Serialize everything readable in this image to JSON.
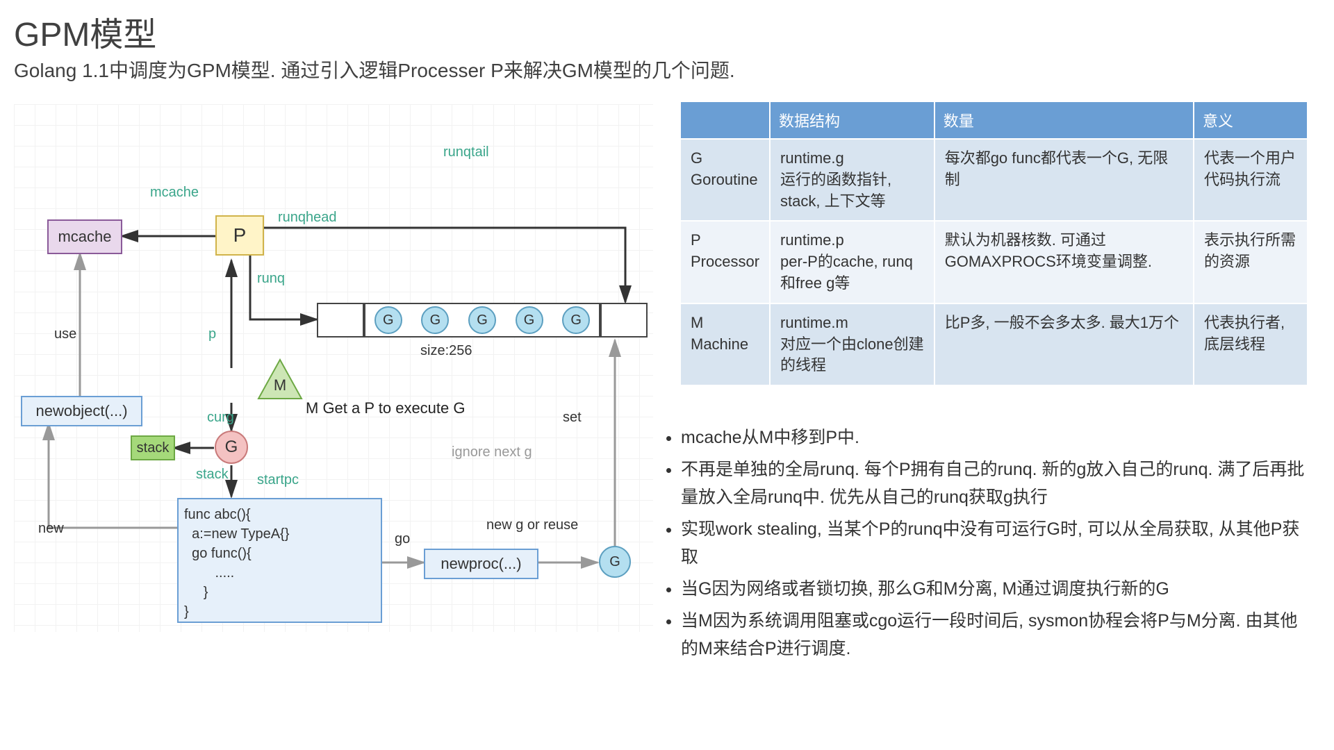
{
  "title": "GPM模型",
  "subtitle": "Golang 1.1中调度为GPM模型. 通过引入逻辑Processer P来解决GM模型的几个问题.",
  "diagram": {
    "mcache": "mcache",
    "newobject": "newobject(...)",
    "p": "P",
    "m": "M",
    "g": "G",
    "stack": "stack",
    "newproc": "newproc(...)",
    "g_end": "G",
    "runq_cells": [
      "G",
      "G",
      "G",
      "G",
      "G"
    ],
    "func_code": "func abc(){\n  a:=new TypeA{}\n  go func(){\n        .....\n     }\n}",
    "labels": {
      "mcache_lbl": "mcache",
      "runqhead": "runqhead",
      "runqtail": "runqtail",
      "runq": "runq",
      "p_lbl": "p",
      "curg": "curg",
      "stack_lbl": "stack",
      "startpc": "startpc",
      "use": "use",
      "new": "new",
      "go": "go",
      "set": "set",
      "ignore": "ignore next g",
      "new_g": "new g or reuse",
      "size": "size:256",
      "m_note": "M Get a P to execute G"
    }
  },
  "table": {
    "headers": [
      "",
      "数据结构",
      "数量",
      "意义"
    ],
    "rows": [
      {
        "name": "G\nGoroutine",
        "struct": "runtime.g\n运行的函数指针, stack, 上下文等",
        "count": "每次都go func都代表一个G, 无限制",
        "meaning": "代表一个用户代码执行流"
      },
      {
        "name": "P\nProcessor",
        "struct": "runtime.p\nper-P的cache, runq和free g等",
        "count": "默认为机器核数. 可通过GOMAXPROCS环境变量调整.",
        "meaning": "表示执行所需的资源"
      },
      {
        "name": "M\nMachine",
        "struct": "runtime.m\n对应一个由clone创建的线程",
        "count": "比P多, 一般不会多太多. 最大1万个",
        "meaning": "代表执行者, 底层线程"
      }
    ]
  },
  "bullets": [
    "mcache从M中移到P中.",
    "不再是单独的全局runq. 每个P拥有自己的runq. 新的g放入自己的runq.  满了后再批量放入全局runq中. 优先从自己的runq获取g执行",
    "实现work stealing, 当某个P的runq中没有可运行G时, 可以从全局获取, 从其他P获取",
    "当G因为网络或者锁切换, 那么G和M分离, M通过调度执行新的G",
    "当M因为系统调用阻塞或cgo运行一段时间后, sysmon协程会将P与M分离. 由其他的M来结合P进行调度."
  ]
}
